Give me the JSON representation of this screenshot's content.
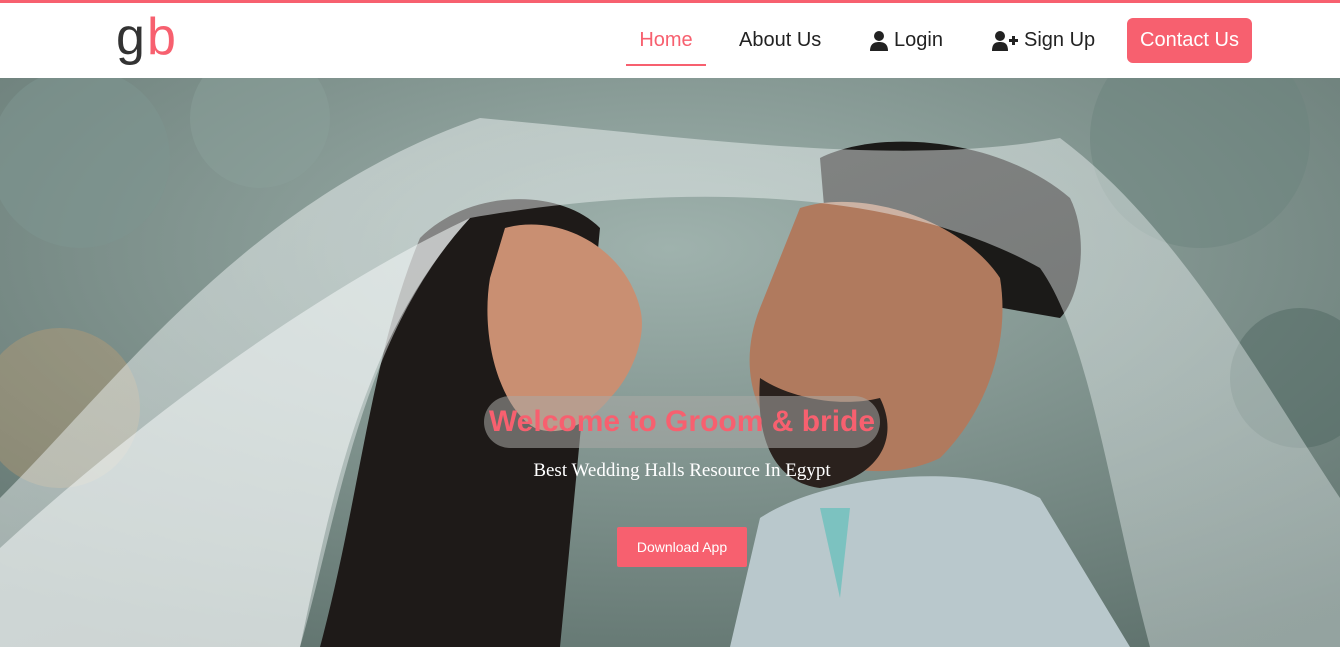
{
  "nav": {
    "logo": {
      "g": "g",
      "b": "b"
    },
    "home": "Home",
    "about": "About Us",
    "login": "Login",
    "signup": "Sign Up",
    "contact": "Contact Us"
  },
  "hero": {
    "title": "Welcome to Groom & bride",
    "subtitle": "Best Wedding Halls Resource In Egypt",
    "button": "Download App"
  },
  "colors": {
    "accent": "#f7606f",
    "text": "#222222",
    "white": "#ffffff"
  },
  "icons": [
    "user-icon",
    "user-plus-icon"
  ]
}
